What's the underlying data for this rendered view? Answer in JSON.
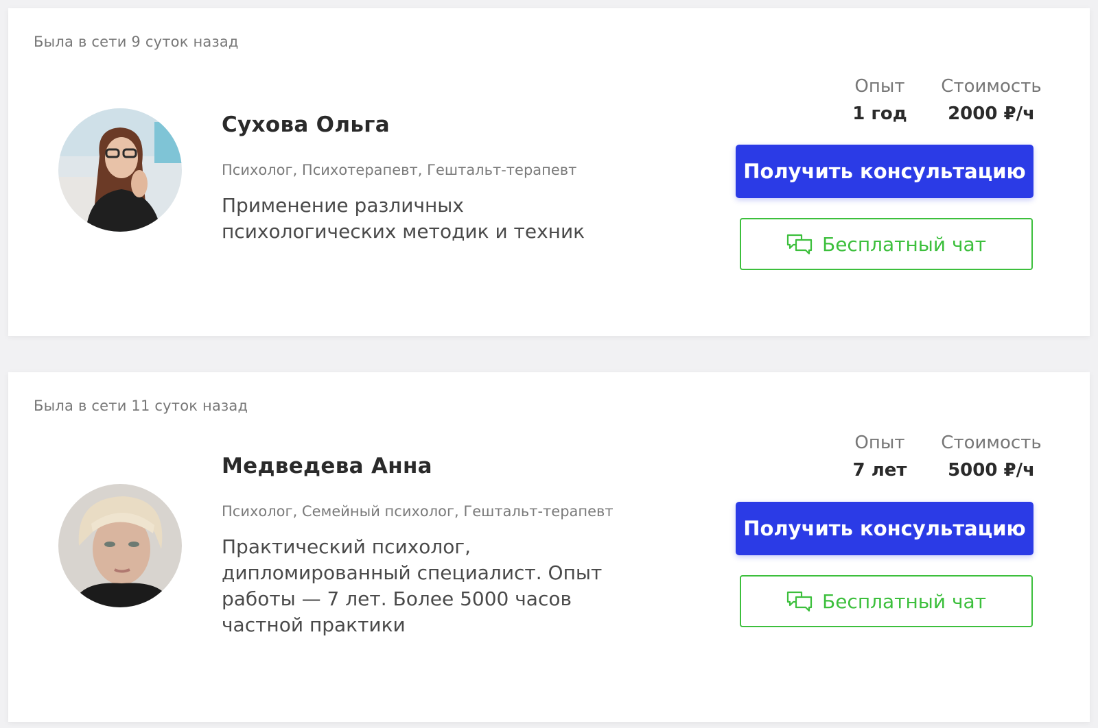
{
  "colors": {
    "primary_button": "#2b3be6",
    "chat_button": "#3cbf3c",
    "background": "#f1f1f3"
  },
  "specialists": [
    {
      "online_status": "Была в сети 9 суток назад",
      "name": "Сухова Ольга",
      "specializations": "Психолог, Психотерапевт, Гештальт-терапевт",
      "description": "Применение различных психологических методик и техник",
      "experience_label": "Опыт",
      "experience_value": "1 год",
      "price_label": "Стоимость",
      "price_value": "2000 ₽/ч",
      "consult_button": "Получить консультацию",
      "chat_button": "Бесплатный чат",
      "chat_icon": "chat-bubbles-icon"
    },
    {
      "online_status": "Была в сети 11 суток назад",
      "name": "Медведева Анна",
      "specializations": "Психолог, Семейный психолог, Гештальт-терапевт",
      "description": "Практический психолог, дипломированный специалист. Опыт работы — 7 лет. Более 5000 часов частной практики",
      "experience_label": "Опыт",
      "experience_value": "7 лет",
      "price_label": "Стоимость",
      "price_value": "5000 ₽/ч",
      "consult_button": "Получить консультацию",
      "chat_button": "Бесплатный чат",
      "chat_icon": "chat-bubbles-icon"
    }
  ]
}
